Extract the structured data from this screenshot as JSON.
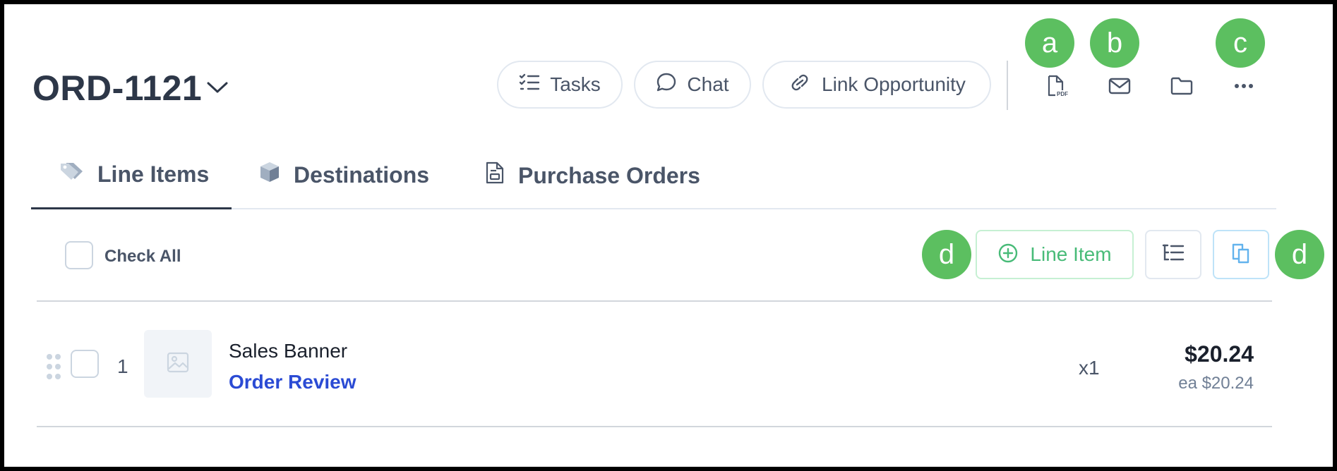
{
  "header": {
    "order_id": "ORD-1121",
    "actions": {
      "tasks_label": "Tasks",
      "chat_label": "Chat",
      "link_label": "Link Opportunity"
    },
    "icons": [
      "pdf-icon",
      "mail-icon",
      "folder-icon",
      "more-icon"
    ]
  },
  "markers": {
    "a": "a",
    "b": "b",
    "c": "c",
    "d1": "d",
    "d2": "d"
  },
  "tabs": [
    {
      "label": "Line Items",
      "icon": "tag-icon",
      "active": true
    },
    {
      "label": "Destinations",
      "icon": "box-icon",
      "active": false
    },
    {
      "label": "Purchase Orders",
      "icon": "document-icon",
      "active": false
    }
  ],
  "toolbar": {
    "check_all_label": "Check All",
    "add_line_item_label": "Line Item"
  },
  "line_items": [
    {
      "index": "1",
      "name": "Sales Banner",
      "status_link": "Order Review",
      "quantity": "x1",
      "total": "$20.24",
      "each": "ea $20.24"
    }
  ],
  "colors": {
    "marker": "#5cbf60",
    "accent_green": "#48bb78",
    "accent_blue": "#63b3ed",
    "link_blue": "#2b4bd4",
    "title": "#2d3748"
  }
}
